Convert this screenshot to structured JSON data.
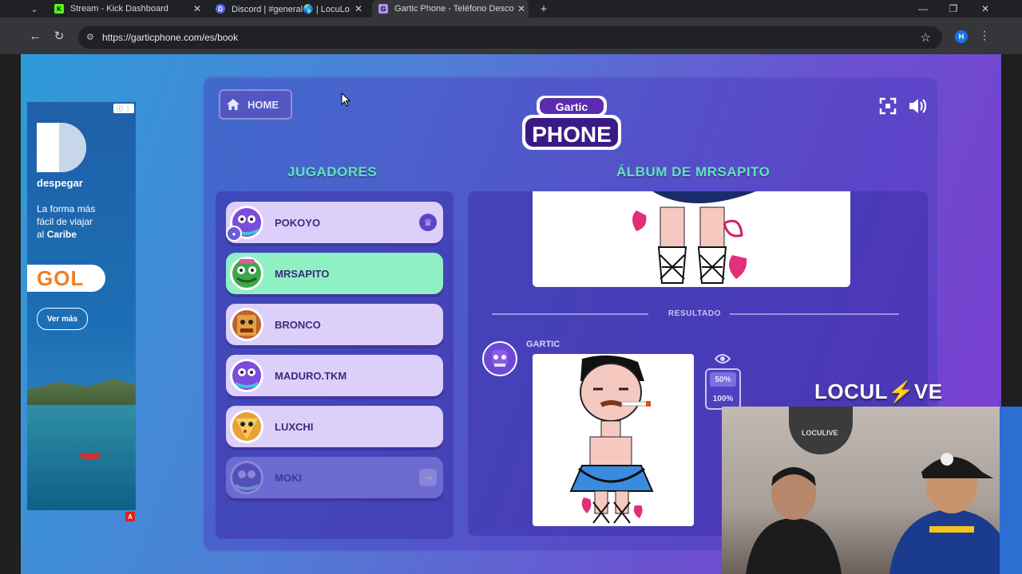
{
  "browser": {
    "tabs": [
      {
        "title": "Stream - Kick Dashboard",
        "favicon": "K",
        "favicon_color": "#53fc18",
        "active": false
      },
      {
        "title": "Discord | #general🌎 | LocuLo",
        "favicon": "D",
        "favicon_color": "#5865f2",
        "active": false
      },
      {
        "title": "Gartic Phone - Teléfono Descon",
        "favicon": "G",
        "favicon_color": "#b58cf0",
        "active": true
      }
    ],
    "url": "https://garticphone.com/es/book",
    "profile_initial": "H"
  },
  "ad": {
    "brand": "despegar",
    "tagline_1": "La forma más",
    "tagline_2": "fácil de viajar",
    "tagline_3": "al ",
    "tagline_bold": "Caribe",
    "partner": "GOL",
    "cta": "Ver más",
    "corner_badge": "A"
  },
  "game": {
    "home_label": "HOME",
    "logo_top": "Gartic",
    "logo_main": "PHONE",
    "players_title": "JUGADORES",
    "album_title": "ÁLBUM DE MRSAPITO",
    "players": [
      {
        "name": "POKOYO",
        "state": "host",
        "avatar_color": "#7c4be0"
      },
      {
        "name": "MRSAPITO",
        "state": "current",
        "avatar_color": "#3aa84a"
      },
      {
        "name": "BRONCO",
        "state": "normal",
        "avatar_color": "#c0622a"
      },
      {
        "name": "MADURO.TKM",
        "state": "normal",
        "avatar_color": "#7c4be0"
      },
      {
        "name": "LUXCHI",
        "state": "normal",
        "avatar_color": "#e8a23a"
      },
      {
        "name": "MOKI",
        "state": "left",
        "avatar_color": "#5250b8"
      }
    ],
    "result_label": "RESULTADO",
    "result_author": "GARTIC",
    "zoom_options": [
      "50%",
      "100%"
    ],
    "zoom_selected": "50%"
  },
  "overlay": {
    "channel_logo_a": "LOCUL",
    "channel_logo_b": "VE",
    "cam_sign": "LOCULIVE"
  }
}
